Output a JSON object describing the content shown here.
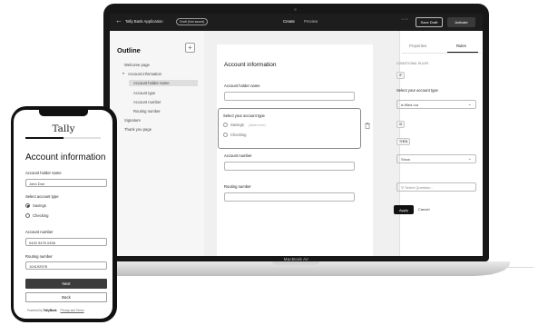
{
  "colors": {
    "topbar": "#1d1d1d",
    "primary_button": "#111111",
    "canvas": "#f0f0f0",
    "selected_item": "#dedede"
  },
  "laptop": {
    "brand_label": "MacBook Air",
    "topbar": {
      "back_icon": "arrow-left-icon",
      "app_title": "Tally Bank Application",
      "badge": "Draft (Not saved)",
      "tabs": [
        "Create",
        "Preview"
      ],
      "active_tab": "Create",
      "more_icon": "more-dots-icon",
      "save_label": "Save Draft",
      "activate_label": "Activate"
    },
    "outline": {
      "title": "Outline",
      "add_icon": "plus-icon",
      "items": [
        "Welcome page",
        "Account information",
        "Account holder name",
        "Account type",
        "Account number",
        "Routing number",
        "Signature",
        "Thank you page"
      ],
      "selected": "Account holder name"
    },
    "canvas": {
      "page_title": "Account information",
      "field1_label": "Account holder name",
      "block_label": "Select your account type",
      "option1": "Savings",
      "option1_hint": "(hidden here)",
      "option2": "Checking",
      "field3_label": "Account number",
      "field4_label": "Routing number",
      "trash_icon": "trash-icon"
    },
    "right_panel": {
      "tabs": [
        "Properties",
        "Rules"
      ],
      "active_tab": "Rules",
      "section": "CONDITIONAL RULES",
      "if_chip": "IF",
      "condition_field": "Select your account type",
      "operator": "is filled out",
      "chip_is": "IS",
      "chip_then": "THEN",
      "action": "Show",
      "search_placeholder": "Select Question...",
      "apply_label": "Apply",
      "cancel_label": "Cancel"
    }
  },
  "phone": {
    "logo": "Tally",
    "progress": 0.5,
    "title": "Account information",
    "field1_label": "Account holder name",
    "field1_value": "John Doe",
    "account_type_label": "Select account type",
    "option1": "Savings",
    "option2": "Checking",
    "selected_option": "Savings",
    "field3_label": "Account number",
    "field3_value": "0420 9476 0456",
    "field4_label": "Routing number",
    "field4_value": "104192578",
    "next_label": "Next",
    "back_label": "Back",
    "footer_prefix": "Powered by",
    "footer_brand": "TallyBank",
    "footer_link": "Privacy and Terms"
  }
}
